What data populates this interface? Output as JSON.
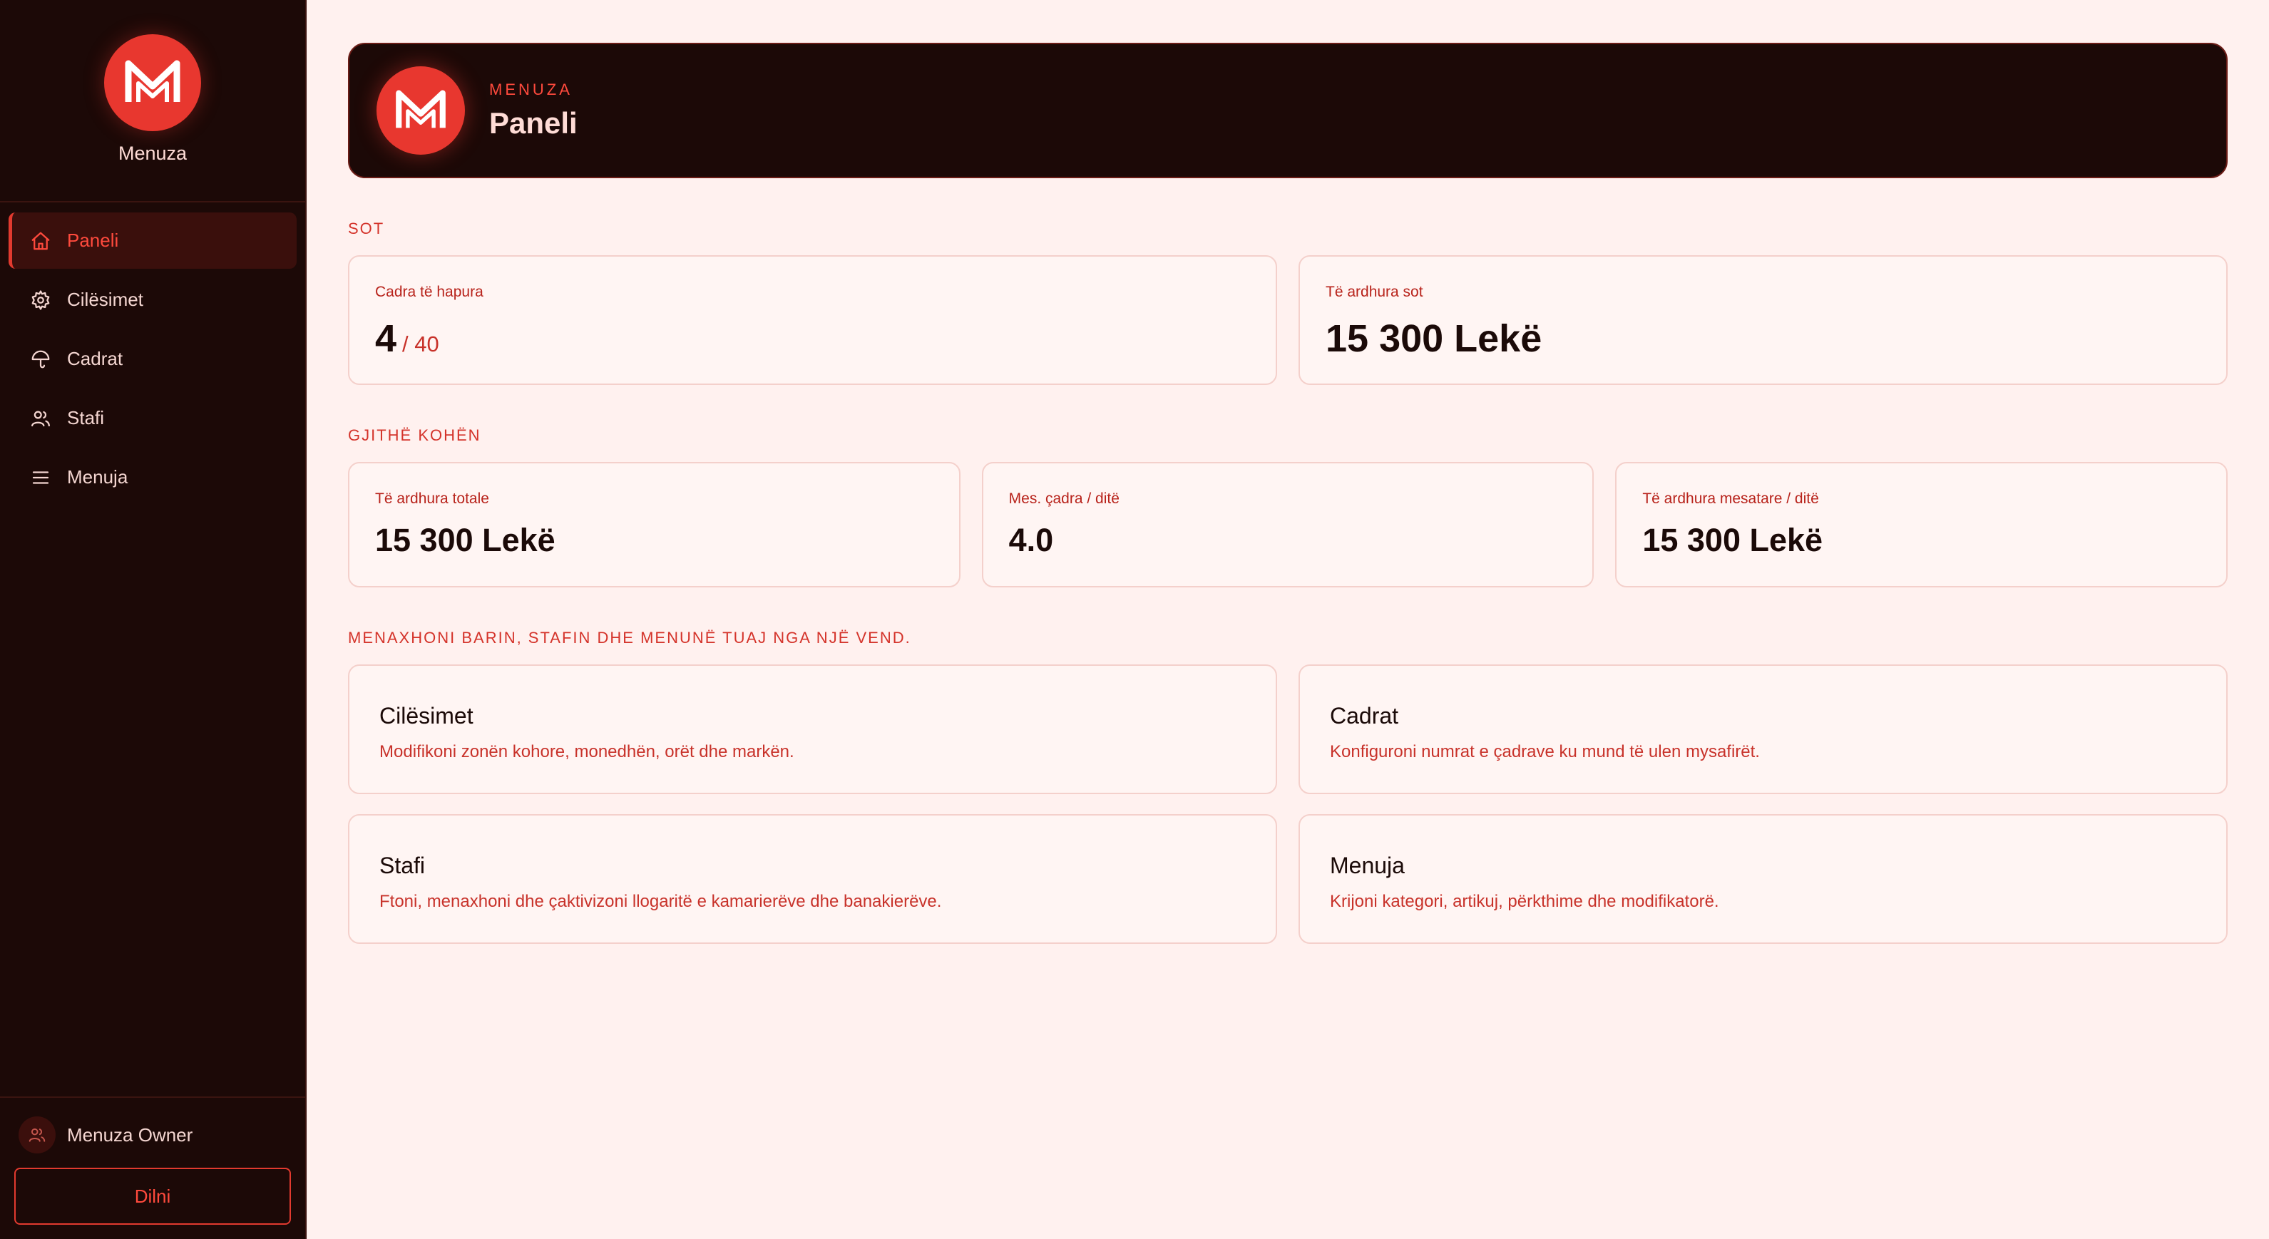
{
  "brand": {
    "name": "Menuza",
    "accent": "#e8372f",
    "background": "#1c0907"
  },
  "nav": {
    "items": [
      {
        "label": "Paneli",
        "icon": "home-icon",
        "active": true
      },
      {
        "label": "Cilësimet",
        "icon": "gear-icon",
        "active": false
      },
      {
        "label": "Cadrat",
        "icon": "umbrella-icon",
        "active": false
      },
      {
        "label": "Stafi",
        "icon": "users-icon",
        "active": false
      },
      {
        "label": "Menuja",
        "icon": "menu-icon",
        "active": false
      }
    ]
  },
  "user": {
    "name": "Menuza Owner",
    "logout_label": "Dilni"
  },
  "header": {
    "kicker": "MENUZA",
    "title": "Paneli"
  },
  "today": {
    "section_label": "SOT",
    "open_umbrellas": {
      "label": "Cadra të hapura",
      "value": "4",
      "total": "/ 40"
    },
    "revenue_today": {
      "label": "Të ardhura sot",
      "value": "15 300 Lekë"
    }
  },
  "all_time": {
    "section_label": "GJITHË KOHËN",
    "total_revenue": {
      "label": "Të ardhura totale",
      "value": "15 300 Lekë"
    },
    "avg_umbrellas": {
      "label": "Mes. çadra / ditë",
      "value": "4.0"
    },
    "avg_revenue": {
      "label": "Të ardhura mesatare / ditë",
      "value": "15 300 Lekë"
    }
  },
  "manage": {
    "section_label": "MENAXHONI BARIN, STAFIN DHE MENUNË TUAJ NGA NJË VEND.",
    "cards": [
      {
        "title": "Cilësimet",
        "description": "Modifikoni zonën kohore, monedhën, orët dhe markën."
      },
      {
        "title": "Cadrat",
        "description": "Konfiguroni numrat e çadrave ku mund të ulen mysafirët."
      },
      {
        "title": "Stafi",
        "description": "Ftoni, menaxhoni dhe çaktivizoni llogaritë e kamarierëve dhe banakierëve."
      },
      {
        "title": "Menuja",
        "description": "Krijoni kategori, artikuj, përkthime dhe modifikatorë."
      }
    ]
  }
}
